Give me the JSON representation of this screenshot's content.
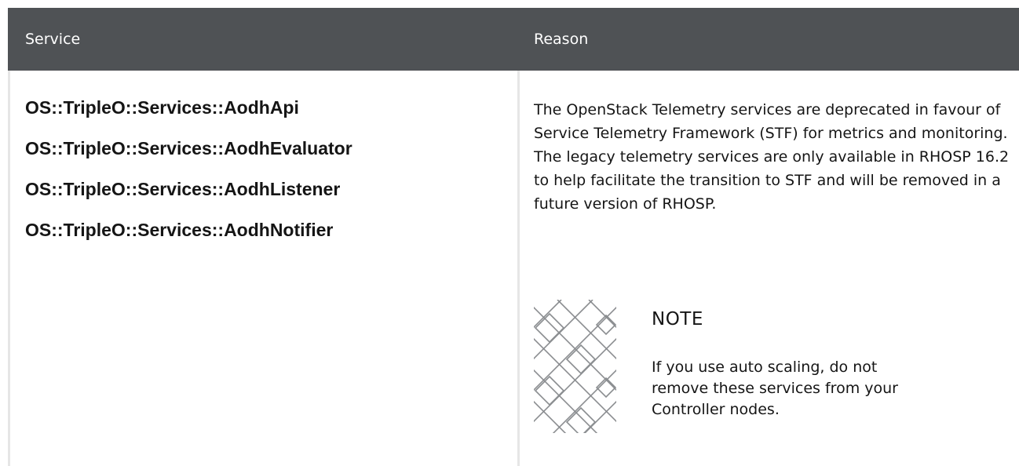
{
  "table": {
    "headers": {
      "service": "Service",
      "reason": "Reason"
    },
    "services": [
      "OS::TripleO::Services::AodhApi",
      "OS::TripleO::Services::AodhEvaluator",
      "OS::TripleO::Services::AodhListener",
      "OS::TripleO::Services::AodhNotifier"
    ],
    "reason": "The OpenStack Telemetry services are deprecated in favour of Service Telemetry Framework (STF) for metrics and monitoring. The legacy telemetry services are only available in RHOSP 16.2 to help facilitate the transition to STF and will be removed in a future version of RHOSP.",
    "note": {
      "icon": "note-pattern-icon",
      "title": "NOTE",
      "body": "If you use auto scaling, do not remove these services from your Controller nodes."
    }
  },
  "colors": {
    "header_bg": "#4f5255",
    "header_text": "#ffffff",
    "divider": "#e6e6e6",
    "text": "#151515"
  }
}
